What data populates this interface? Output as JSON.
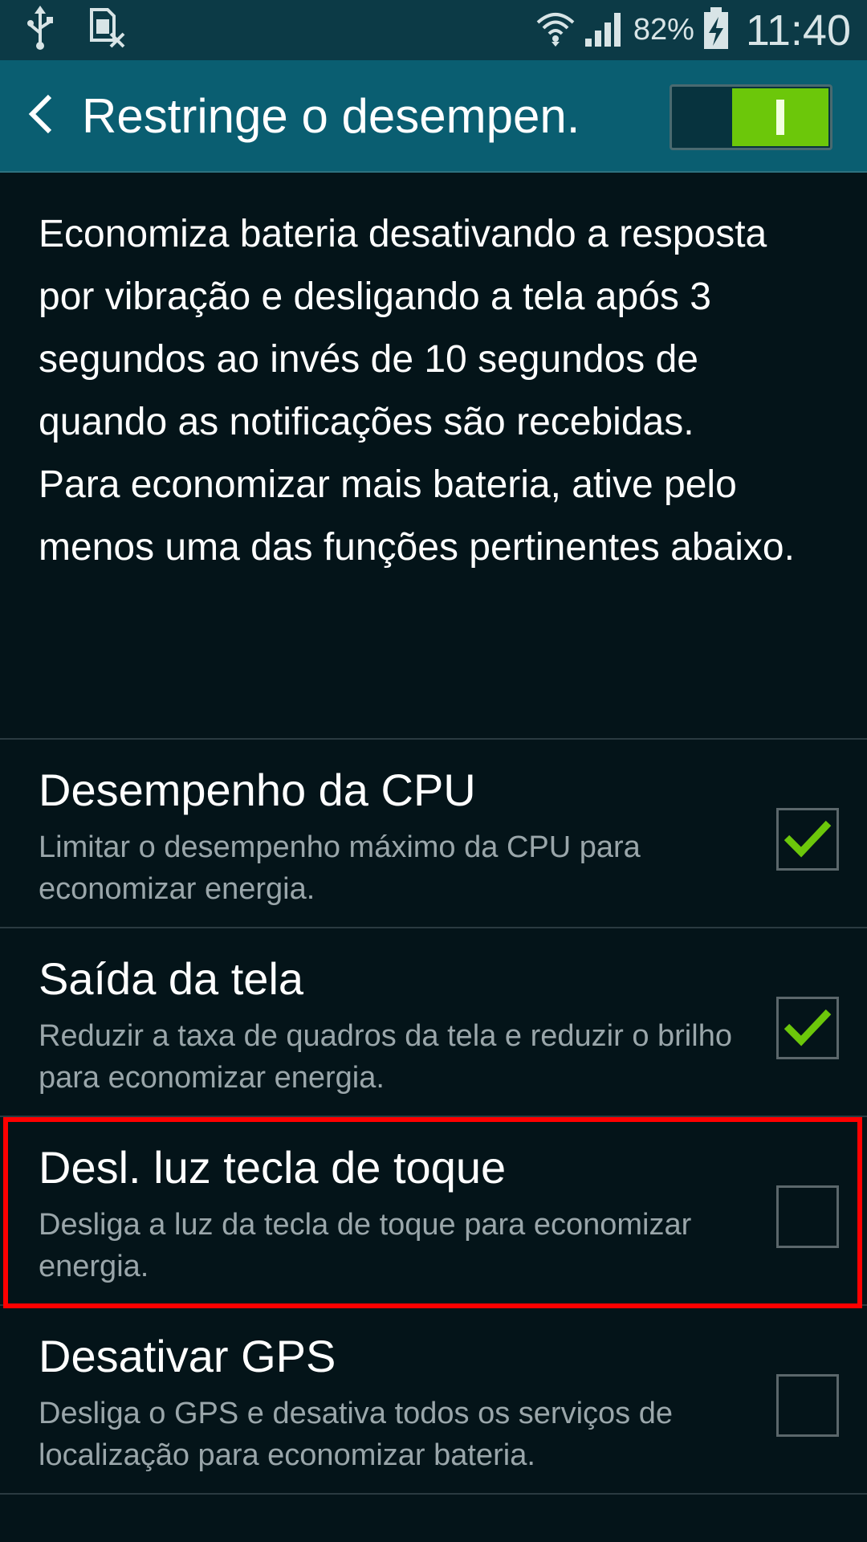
{
  "status_bar": {
    "battery_percent": "82%",
    "time": "11:40",
    "icons": [
      "usb-icon",
      "sim-card-disabled-icon",
      "wifi-icon",
      "cell-signal-icon",
      "battery-charging-icon"
    ]
  },
  "action_bar": {
    "title": "Restringe o desempen.",
    "back_icon": "chevron-left-icon",
    "master_switch_on": true
  },
  "description": {
    "paragraph1": "Economiza bateria desativando a resposta por vibração e desligando a tela após 3 segundos ao invés de 10 segundos de quando as notificações são recebidas.",
    "paragraph2": "Para economizar mais bateria, ative pelo menos uma das funções pertinentes abaixo."
  },
  "options": [
    {
      "title": "Desempenho da CPU",
      "description": "Limitar o desempenho máximo da CPU para economizar energia.",
      "checked": true
    },
    {
      "title": "Saída da tela",
      "description": "Reduzir a taxa de quadros da tela e reduzir o brilho para economizar energia.",
      "checked": true
    },
    {
      "title": "Desl. luz tecla de toque",
      "description": "Desliga a luz da tecla de toque para economizar energia.",
      "checked": false,
      "highlighted": true
    },
    {
      "title": "Desativar GPS",
      "description": "Desliga o GPS e desativa todos os serviços de localização para economizar bateria.",
      "checked": false
    }
  ],
  "colors": {
    "status_bar": "#0c3a46",
    "action_bar": "#0a5e71",
    "background": "#041419",
    "accent_green": "#6cc70a",
    "highlight_red": "#ff0000",
    "secondary_text": "#9aa6aa"
  }
}
